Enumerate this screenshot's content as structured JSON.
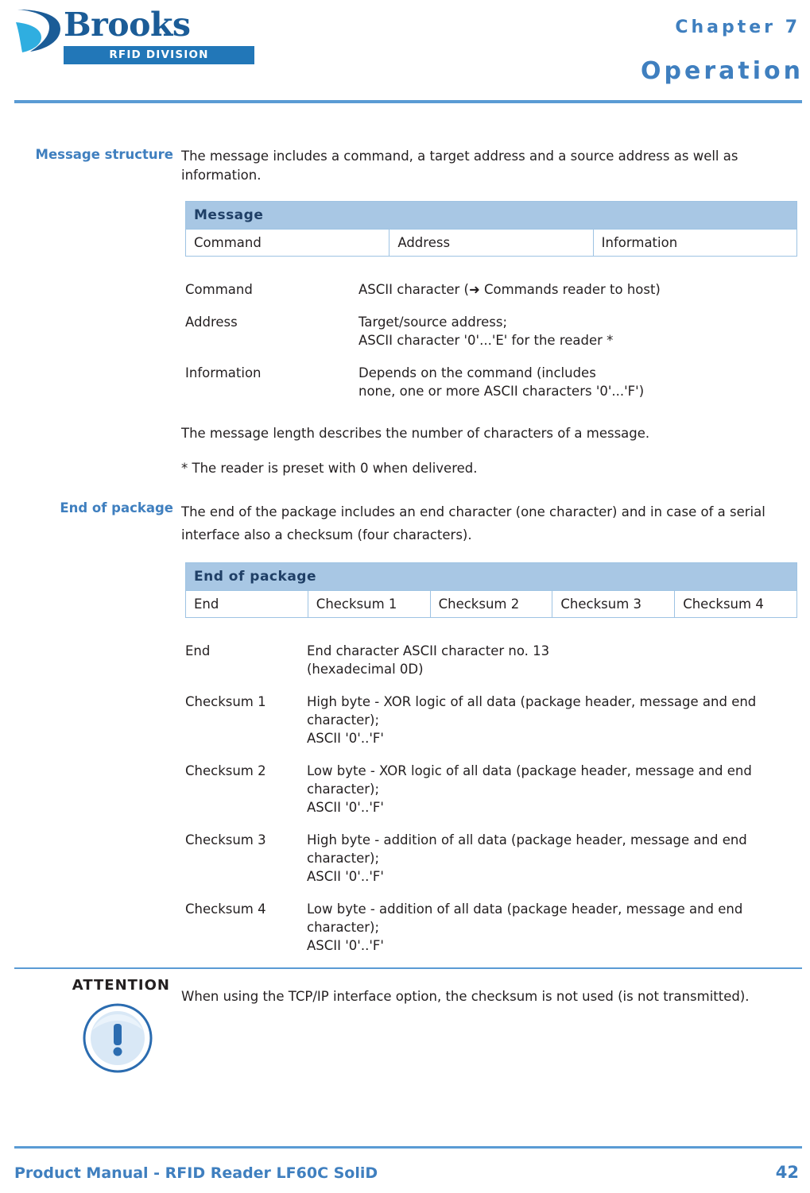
{
  "header": {
    "logo_brand": "Brooks",
    "logo_division": "RFID DIVISION",
    "chapter_label": "Chapter 7",
    "chapter_title": "Operation"
  },
  "sections": {
    "message_structure": {
      "label": "Message structure",
      "intro": "The message includes a command, a target address and a source address as well as information.",
      "table": {
        "header": "Message",
        "cells": [
          "Command",
          "Address",
          "Information"
        ]
      },
      "definitions": [
        {
          "term": "Command",
          "def": "ASCII character (➜ Commands reader to host)"
        },
        {
          "term": "Address",
          "def": "Target/source address;\nASCII character '0'...'E' for the reader *"
        },
        {
          "term": "Information",
          "def": "Depends on the command (includes\nnone, one or more ASCII characters '0'...'F')"
        }
      ],
      "note1": "The message length describes the number of characters of a message.",
      "note2": "* The reader is preset with 0 when delivered."
    },
    "end_of_package": {
      "label": "End of package",
      "intro": "The end of the package includes an end character (one character) and in case of a serial interface also a checksum (four characters).",
      "table": {
        "header": "End of package",
        "cells": [
          "End",
          "Checksum 1",
          "Checksum 2",
          "Checksum 3",
          "Checksum 4"
        ]
      },
      "definitions": [
        {
          "term": "End",
          "def": "End character ASCII character no. 13\n(hexadecimal 0D)"
        },
        {
          "term": "Checksum 1",
          "def": "High byte - XOR logic of all data (package header, message and end character);\nASCII '0'..'F'"
        },
        {
          "term": "Checksum 2",
          "def": "Low byte - XOR logic of all data (package header, message and end character);\nASCII '0'..'F'"
        },
        {
          "term": "Checksum 3",
          "def": "High byte - addition of all data (package header, message and end character);\nASCII '0'..'F'"
        },
        {
          "term": "Checksum 4",
          "def": "Low byte - addition of all data (package header, message and end character);\nASCII '0'..'F'"
        }
      ]
    },
    "attention": {
      "label": "ATTENTION",
      "icon": "attention-exclamation-icon",
      "text": "When using the TCP/IP interface option, the checksum is not used (is not transmitted)."
    }
  },
  "footer": {
    "title": "Product Manual - RFID Reader LF60C SoliD",
    "page": "42"
  },
  "colors": {
    "accent": "#3f7fbf",
    "rule": "#5a9bd4",
    "table_header": "#a8c7e4",
    "table_border": "#9ec3e3"
  }
}
